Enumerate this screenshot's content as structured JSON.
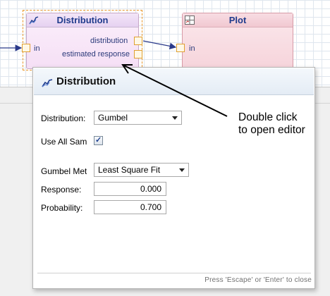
{
  "canvas": {
    "distribution_node": {
      "title": "Distribution",
      "input_port_label": "in",
      "output_ports": [
        "distribution",
        "estimated response"
      ]
    },
    "plot_node": {
      "title": "Plot",
      "input_port_label": "in"
    }
  },
  "editor": {
    "title": "Distribution",
    "distribution_label": "Distribution:",
    "distribution_value": "Gumbel",
    "use_all_label": "Use All Samples",
    "use_all_checked": true,
    "method_label": "Gumbel Method",
    "method_value": "Least Square Fit",
    "response_label": "Response:",
    "response_value": "0.000",
    "probability_label": "Probability:",
    "probability_value": "0.700",
    "footer_hint": "Press 'Escape' or 'Enter' to close"
  },
  "annotation": {
    "line1": "Double click",
    "line2": "to open editor"
  },
  "colors": {
    "node_title_text": "#1f3b8c",
    "port_border": "#e0a030",
    "selection_border": "#e8962a",
    "connector": "#2b3a8a"
  },
  "icons": [
    "distribution-chart-icon",
    "plot-icon",
    "checkbox-check-icon",
    "dropdown-caret-icon"
  ]
}
